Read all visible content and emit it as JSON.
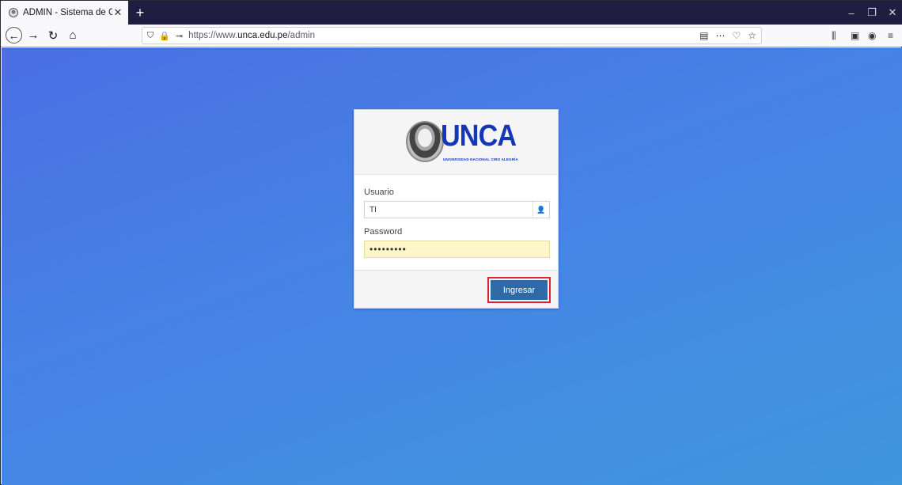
{
  "browser": {
    "tab_title": "ADMIN - Sistema de Gestion",
    "tab_close": "✕",
    "new_tab": "+",
    "url_prefix": "https://www.",
    "url_domain": "unca.edu.pe",
    "url_path": "/admin",
    "window": {
      "minimize": "–",
      "restore": "❐",
      "close": "✕"
    }
  },
  "logo": {
    "word": "UNCA",
    "subtitle": "UNIVERSIDAD NACIONAL CIRO ALEGRÍA"
  },
  "form": {
    "user_label": "Usuario",
    "user_value": "TI",
    "password_label": "Password",
    "password_value": "•••••••••",
    "submit_label": "Ingresar"
  },
  "colors": {
    "brand": "#1437b8",
    "button": "#2f6aa8",
    "highlight": "#e02432"
  }
}
